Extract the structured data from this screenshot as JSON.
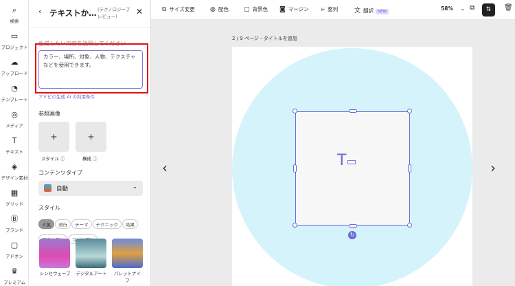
{
  "rail": [
    {
      "icon": "search-icon",
      "label": "検索"
    },
    {
      "icon": "folder-icon",
      "label": "プロジェクト"
    },
    {
      "icon": "upload-icon",
      "label": "アップロード"
    },
    {
      "icon": "template-icon",
      "label": "テンプレート"
    },
    {
      "icon": "media-icon",
      "label": "メディア"
    },
    {
      "icon": "text-icon",
      "label": "テキスト"
    },
    {
      "icon": "shapes-icon",
      "label": "デザイン素材"
    },
    {
      "icon": "grid-icon",
      "label": "グリッド"
    },
    {
      "icon": "brand-icon",
      "label": "ブランド"
    },
    {
      "icon": "addon-icon",
      "label": "アドオン"
    },
    {
      "icon": "crown-icon",
      "label": "プレミアム"
    }
  ],
  "panel": {
    "title": "テキストか…",
    "beta": "(テクノロジープレビュー)",
    "prompt_label": "生成したい内容を説明してください",
    "prompt_placeholder": "カラー、場所、対象、人物、テクスチャなどを使用できます。",
    "terms_link": "アドビの生成 AI の利用条件",
    "ref_label": "参照画像",
    "ref_style": "スタイル",
    "ref_comp": "構成",
    "plus": "+",
    "content_type_label": "コンテンツタイプ",
    "content_type_value": "自動",
    "style_label": "スタイル",
    "chips": [
      "人気",
      "流行",
      "テーマ",
      "テクニック",
      "効果",
      "マテリアル",
      "コンセプト"
    ],
    "thumbs": [
      "シンセウェーブ",
      "デジタルアート",
      "パレットナイフ"
    ]
  },
  "toolbar": {
    "resize": "サイズ変更",
    "color": "配色",
    "bg": "背景色",
    "margin": "マージン",
    "align": "整列",
    "translate": "翻訳",
    "new": "NEW",
    "zoom": "58%"
  },
  "canvas": {
    "page_info": "2 / 9 ページ - タイトルを追加"
  },
  "colors": {
    "accent": "#6a6ad8",
    "highlight": "#e01010",
    "circle": "#d5f3fb"
  }
}
